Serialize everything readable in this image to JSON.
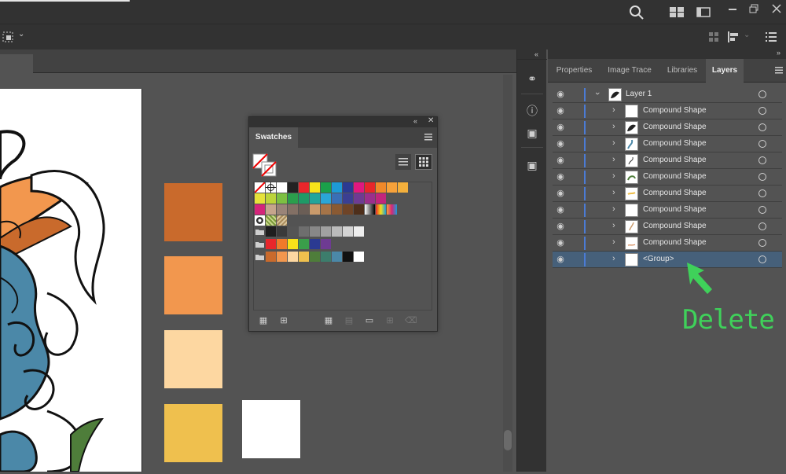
{
  "colors": {
    "accent": "#3fd15a",
    "selection": "#46607a"
  },
  "layers_panel": {
    "tabs": [
      {
        "label": "Properties",
        "active": false
      },
      {
        "label": "Image Trace",
        "active": false
      },
      {
        "label": "Libraries",
        "active": false
      },
      {
        "label": "Layers",
        "active": true
      }
    ],
    "layer_name": "Layer 1",
    "rows": [
      {
        "label": "Compound Shape"
      },
      {
        "label": "Compound Shape"
      },
      {
        "label": "Compound Shape"
      },
      {
        "label": "Compound Shape"
      },
      {
        "label": "Compound Shape"
      },
      {
        "label": "Compound Shape"
      },
      {
        "label": "Compound Shape"
      },
      {
        "label": "Compound Shape"
      },
      {
        "label": "Compound Shape"
      },
      {
        "label": "<Group>",
        "selected": true
      }
    ]
  },
  "swatches_panel": {
    "tab_label": "Swatches",
    "rows": [
      [
        "none",
        "reg",
        "#ffffff",
        "#222222",
        "#e8262b",
        "#f7e21a",
        "#1aa04a",
        "#1d9ad6",
        "#2b3a92",
        "#e0187f",
        "#e8262b",
        "#f0892a",
        "#f7a23a",
        "#f4b03c"
      ],
      [
        "#e6e23a",
        "#bcd43a",
        "#7dc042",
        "#2b9e4c",
        "#1f9a66",
        "#23a59a",
        "#2aa6d6",
        "#3a6fb6",
        "#3b3f92",
        "#6e3b92",
        "#9b2f8c",
        "#c2257c"
      ],
      [
        "#d4257a",
        "#c6a58c",
        "#9a8478",
        "#837065",
        "#6b5e56",
        "#c99a6b",
        "#a57448",
        "#8a5a33",
        "#6f4427",
        "#4e2f1b",
        "grad1",
        "grad2",
        "grad3"
      ],
      [
        "pat1",
        "pat2",
        "pat3"
      ],
      [
        "folder",
        "#1e1e1e",
        "#3a3a3a",
        "#555555",
        "#6e6e6e",
        "#888888",
        "#a1a1a1",
        "#bbbbbb",
        "#d4d4d4",
        "#eeeeee"
      ],
      [
        "folder",
        "#e8262b",
        "#f07a2a",
        "#f7e21a",
        "#3a9e4a",
        "#2b3a92",
        "#6e3b92"
      ],
      [
        "folder",
        "#c96a2c",
        "#f2974e",
        "#fdd7a1",
        "#efc04e",
        "#4e7d3a",
        "#3c7d6c",
        "#4b88a8",
        "#111111",
        "#ffffff"
      ]
    ]
  },
  "canvas": {
    "swatch_squares": [
      "#c96a2c",
      "#f2974e",
      "#fdd7a1",
      "#efc04e",
      "#ffffff"
    ]
  },
  "annotation": {
    "label": "Delete"
  }
}
